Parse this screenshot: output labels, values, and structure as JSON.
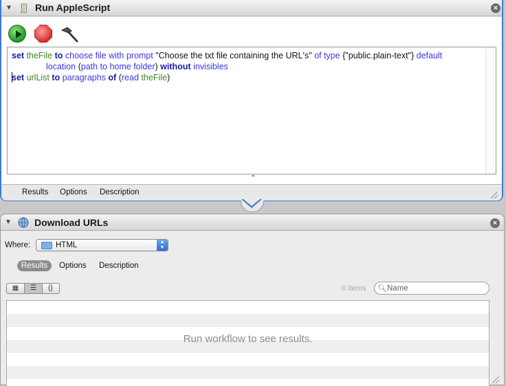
{
  "colors": {
    "selection_border": "#3e78d4",
    "keyword": "#1a1aa8",
    "variable": "#3c8a1f",
    "command": "#3a36e6"
  },
  "action1": {
    "title": "Run AppleScript",
    "icon": "script-icon",
    "toolbar": {
      "run_icon": "play-icon",
      "stop_icon": "stop-icon",
      "compile_icon": "hammer-icon"
    },
    "script": {
      "line1": {
        "t1": "set",
        "t2": "theFile",
        "t3": "to",
        "t4": "choose file",
        "t5": "with prompt",
        "t6": "\"Choose the txt file containing the URL's\"",
        "t7": "of type",
        "t8": "{\"public.plain-text\"}",
        "t9": "default"
      },
      "line2": {
        "t1": "location",
        "t2": "(",
        "t3": "path to",
        "t4": "home folder",
        "t5": ")",
        "t6": "without",
        "t7": "invisibles"
      },
      "line3": {
        "t1": "set",
        "t2": "urlList",
        "t3": "to",
        "t4": "paragraphs",
        "t5": "of",
        "t6": "(",
        "t7": "read",
        "t8": "theFile",
        "t9": ")"
      }
    },
    "tabs": [
      "Results",
      "Options",
      "Description"
    ]
  },
  "action2": {
    "title": "Download URLs",
    "icon": "globe-icon",
    "where_label": "Where:",
    "where_value": "HTML",
    "tabs": [
      "Results",
      "Options",
      "Description"
    ],
    "view_modes": [
      "icon-view-icon",
      "list-view-icon",
      "code-view-icon"
    ],
    "items_count": "0 items",
    "search_placeholder": "Name",
    "empty_message": "Run workflow to see results."
  }
}
